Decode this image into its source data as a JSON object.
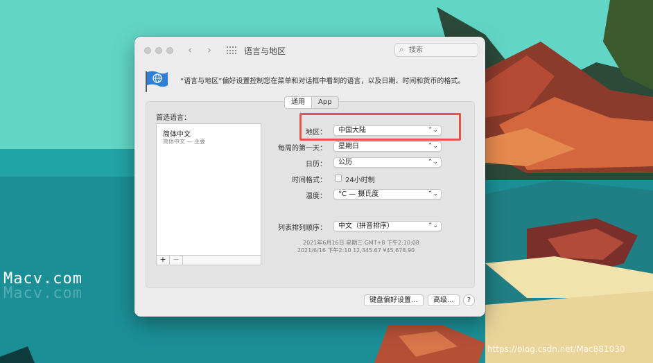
{
  "window": {
    "title": "语言与地区",
    "search_placeholder": "搜索",
    "description": "“语言与地区”偏好设置控制您在菜单和对话框中看到的语言，以及日期、时间和货币的格式。"
  },
  "tabs": [
    {
      "label": "通用",
      "active": true
    },
    {
      "label": "App",
      "active": false
    }
  ],
  "preferred_languages": {
    "label": "首选语言：",
    "items": [
      {
        "name": "简体中文",
        "detail": "简体中文 — 主要"
      }
    ],
    "add_label": "+",
    "remove_label": "−"
  },
  "settings": {
    "region": {
      "label": "地区：",
      "value": "中国大陆"
    },
    "first_day": {
      "label": "每周的第一天：",
      "value": "星期日"
    },
    "calendar": {
      "label": "日历：",
      "value": "公历"
    },
    "time_format": {
      "label": "时间格式：",
      "checkbox_label": "24小时制",
      "checked": false
    },
    "temperature": {
      "label": "温度：",
      "value": "°C — 摄氏度"
    },
    "sort_order": {
      "label": "列表排列顺序：",
      "value": "中文（拼音排序）"
    }
  },
  "samples": {
    "line1": "2021年6月16日 星期三 GMT+8 下午2:10:08",
    "line2": "2021/6/16 下午2:10    12,345.67    ¥45,678.90"
  },
  "buttons": {
    "keyboard": "键盘偏好设置...",
    "advanced": "高级...",
    "help": "?"
  },
  "watermark": {
    "main": "Macv.com",
    "reflection": "Macv.com"
  },
  "credit": "https://blog.csdn.net/Mac881030",
  "colors": {
    "highlight": "#e0574a",
    "wallpaper_top": "#5fd3c5",
    "sea": "#1d8e94"
  }
}
